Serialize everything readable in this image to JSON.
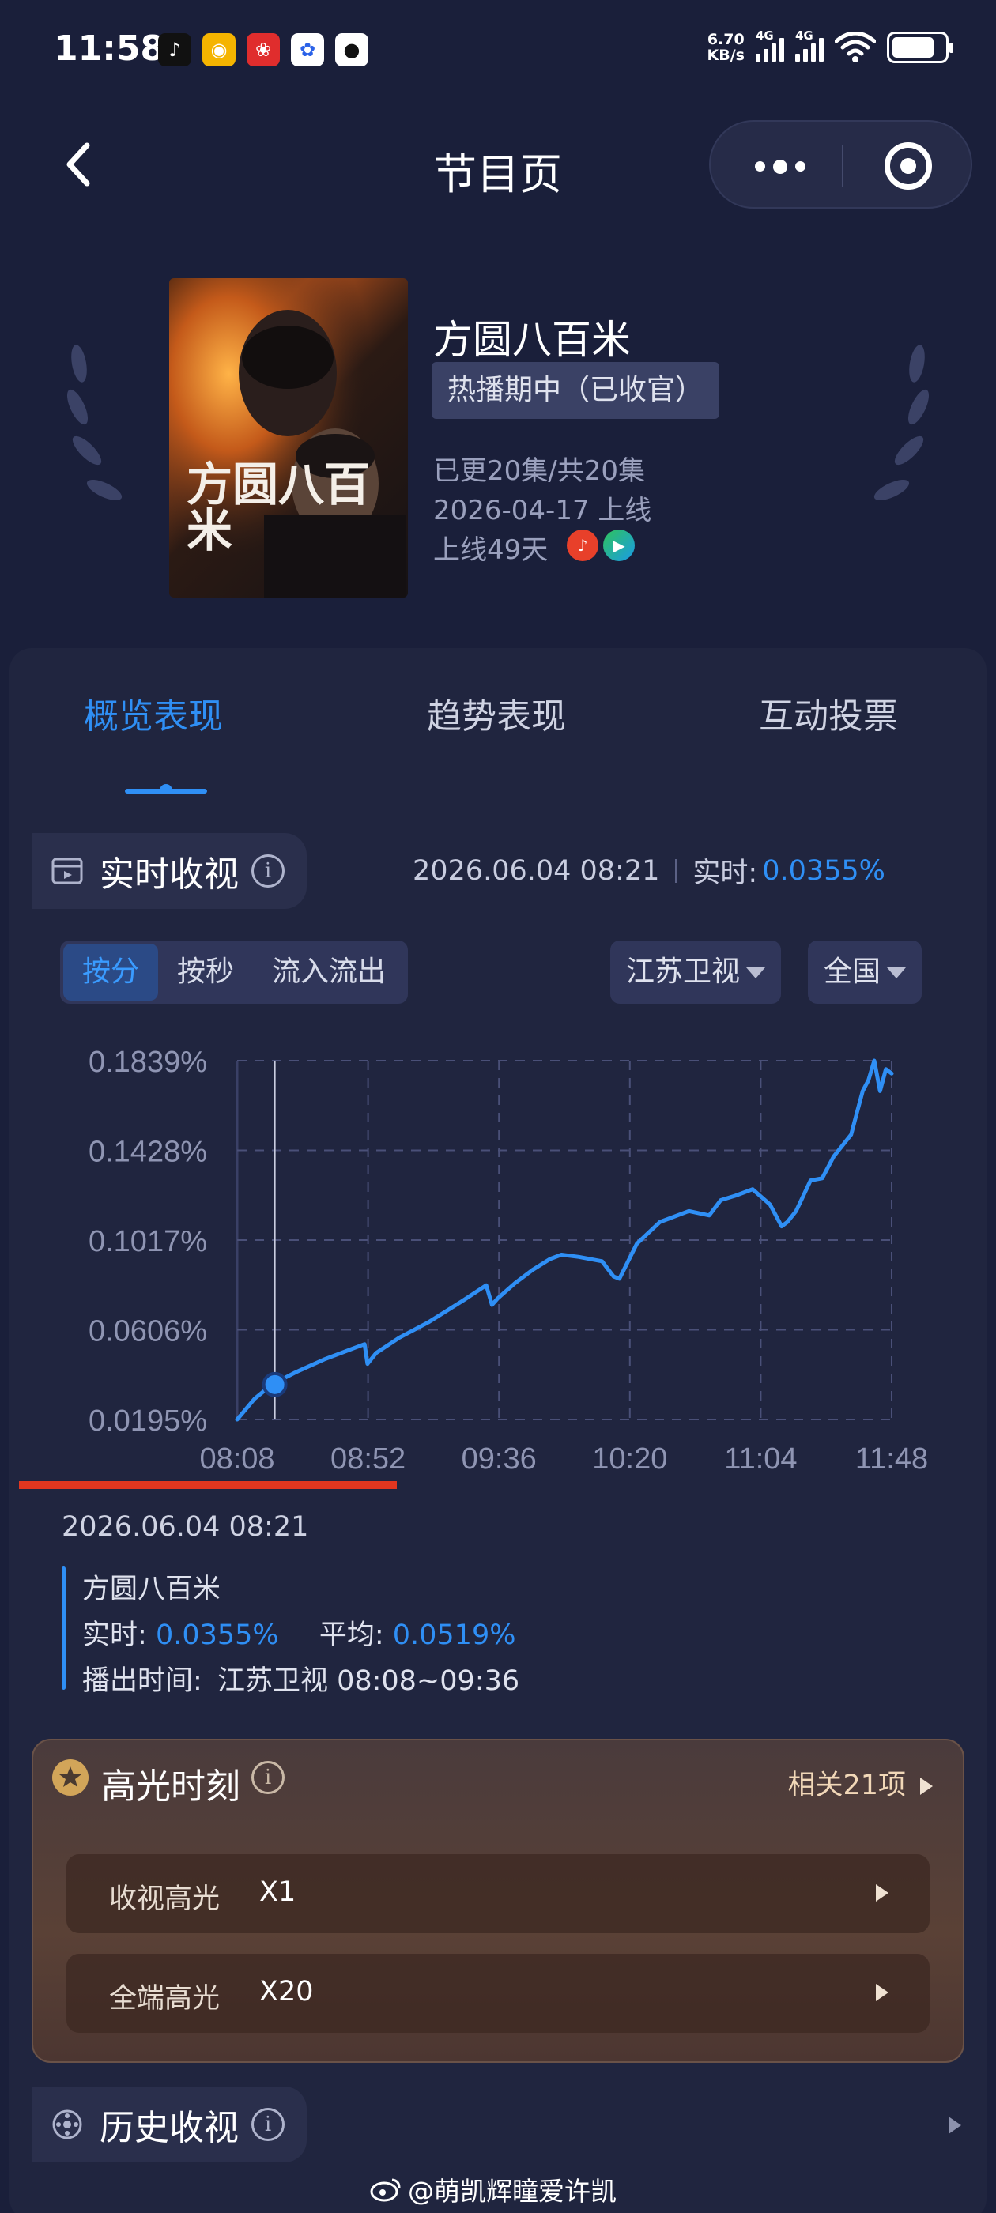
{
  "status_bar": {
    "time": "11:58",
    "net_speed_value": "6.70",
    "net_speed_unit": "KB/s",
    "sim1_label": "4G",
    "sim2_label": "4G",
    "app_icons": [
      "tiktok-icon",
      "weibo-icon",
      "pinduoduo-icon",
      "baidu-icon",
      "qq-icon"
    ]
  },
  "nav": {
    "title": "节目页"
  },
  "show": {
    "name": "方圆八百米",
    "poster_title": "方圆八百米",
    "status": "热播期中（已收官）",
    "episodes": "已更20集/共20集",
    "release": "2026-04-17 上线",
    "days_online": "上线49天"
  },
  "tabs": [
    {
      "label": "概览表现",
      "active": true
    },
    {
      "label": "趋势表现",
      "active": false
    },
    {
      "label": "互动投票",
      "active": false
    }
  ],
  "realtime": {
    "title": "实时收视",
    "info_icon": "i",
    "timestamp": "2026.06.04 08:21",
    "realtime_label": "实时:",
    "realtime_value": "0.0355%",
    "segments": [
      {
        "label": "按分",
        "active": true
      },
      {
        "label": "按秒",
        "active": false
      },
      {
        "label": "流入流出",
        "active": false
      }
    ],
    "channel_dropdown": "江苏卫视",
    "region_dropdown": "全国"
  },
  "chart_data": {
    "type": "line",
    "title": "",
    "xlabel": "",
    "ylabel": "",
    "y_ticks": [
      "0.1839%",
      "0.1428%",
      "0.1017%",
      "0.0606%",
      "0.0195%"
    ],
    "x_ticks": [
      "08:08",
      "08:52",
      "09:36",
      "10:20",
      "11:04",
      "11:48"
    ],
    "ylim": [
      0.0195,
      0.1839
    ],
    "x_range_minutes": [
      0,
      226
    ],
    "series": [
      {
        "color": "#2f8ff5",
        "x_minutes": [
          0,
          6,
          12,
          20,
          30,
          40,
          44,
          45,
          48,
          56,
          66,
          78,
          86,
          88,
          90,
          96,
          102,
          108,
          112,
          118,
          126,
          130,
          132,
          138,
          146,
          156,
          163,
          167,
          172,
          178,
          184,
          188,
          190,
          193,
          198,
          202,
          206,
          212,
          214,
          216,
          218,
          220,
          222,
          224,
          226
        ],
        "values": [
          0.0195,
          0.029,
          0.0355,
          0.041,
          0.047,
          0.052,
          0.054,
          0.045,
          0.05,
          0.057,
          0.064,
          0.074,
          0.081,
          0.072,
          0.075,
          0.082,
          0.088,
          0.093,
          0.095,
          0.094,
          0.092,
          0.085,
          0.084,
          0.1,
          0.11,
          0.115,
          0.113,
          0.12,
          0.122,
          0.125,
          0.118,
          0.108,
          0.11,
          0.115,
          0.129,
          0.13,
          0.14,
          0.15,
          0.16,
          0.17,
          0.175,
          0.1839,
          0.17,
          0.18,
          0.178
        ]
      }
    ],
    "marker": {
      "x_minutes": 13,
      "value": 0.0355
    }
  },
  "tooltip": {
    "date": "2026.06.04 08:21",
    "name": "方圆八百米",
    "realtime_label": "实时:",
    "realtime_value": "0.0355%",
    "average_label": "平均:",
    "average_value": "0.0519%",
    "airtime_label": "播出时间:",
    "airtime_value": "江苏卫视 08:08~09:36"
  },
  "highlights": {
    "title": "高光时刻",
    "related": "相关21项",
    "rows": [
      {
        "label": "收视高光",
        "value": "X1"
      },
      {
        "label": "全端高光",
        "value": "X20"
      }
    ]
  },
  "history": {
    "title": "历史收视"
  },
  "watermark": "@萌凯辉瞳爱许凯",
  "colors": {
    "background": "#1a1f3a",
    "accent_blue": "#2f8ff5",
    "underline_red": "#e2361f",
    "highlight_gold": "#d2a559"
  }
}
